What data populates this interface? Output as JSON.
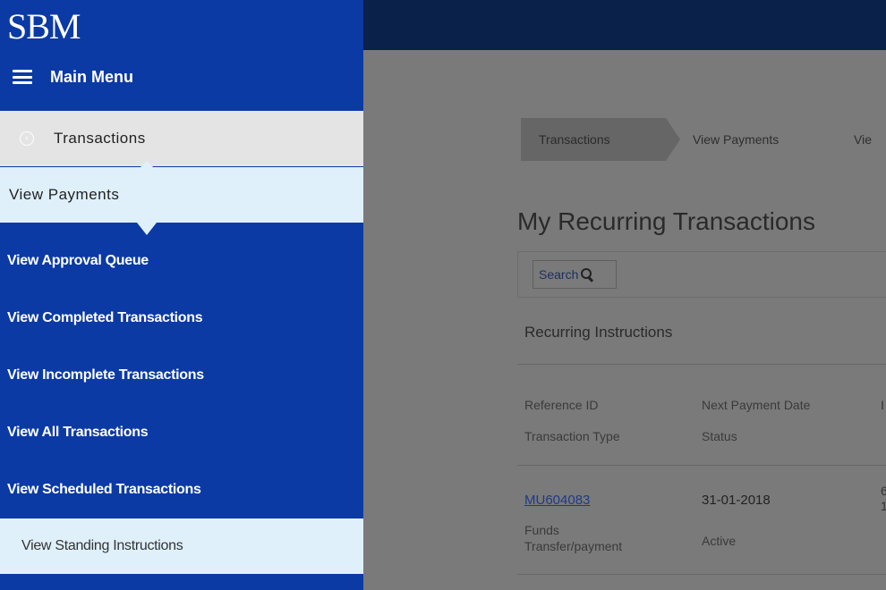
{
  "brand": {
    "logo_text": "SBM"
  },
  "sidebar": {
    "menu_label": "Main Menu",
    "parent_label": "Transactions",
    "current_label": "View Payments",
    "items": [
      {
        "label": "View Approval Queue"
      },
      {
        "label": "View Completed Transactions"
      },
      {
        "label": "View Incomplete Transactions"
      },
      {
        "label": "View All Transactions"
      },
      {
        "label": "View Scheduled Transactions"
      },
      {
        "label": "View Standing Instructions",
        "selected": true
      }
    ]
  },
  "breadcrumb": [
    "Transactions",
    "View Payments",
    "Vie"
  ],
  "main": {
    "title": "My Recurring Transactions",
    "search_label": "Search",
    "section_title": "Recurring Instructions",
    "columns": {
      "col1_line1": "Reference ID",
      "col1_line2": "Transaction Type",
      "col2_line1": "Next Payment Date",
      "col2_line2": "Status",
      "col3_partial": "I"
    },
    "rows": [
      {
        "reference_id": "MU604083",
        "next_payment_date": "31-01-2018",
        "transaction_type": "Funds Transfer/payment",
        "status": "Active",
        "col3_partial_line1": "6",
        "col3_partial_line2": "1"
      }
    ]
  },
  "colors": {
    "sidebar_bg": "#0b3aa4",
    "topbar_bg": "#0a214a",
    "selected_item_bg": "#dff0fb",
    "overlay_bg": "#7a7a7a"
  }
}
